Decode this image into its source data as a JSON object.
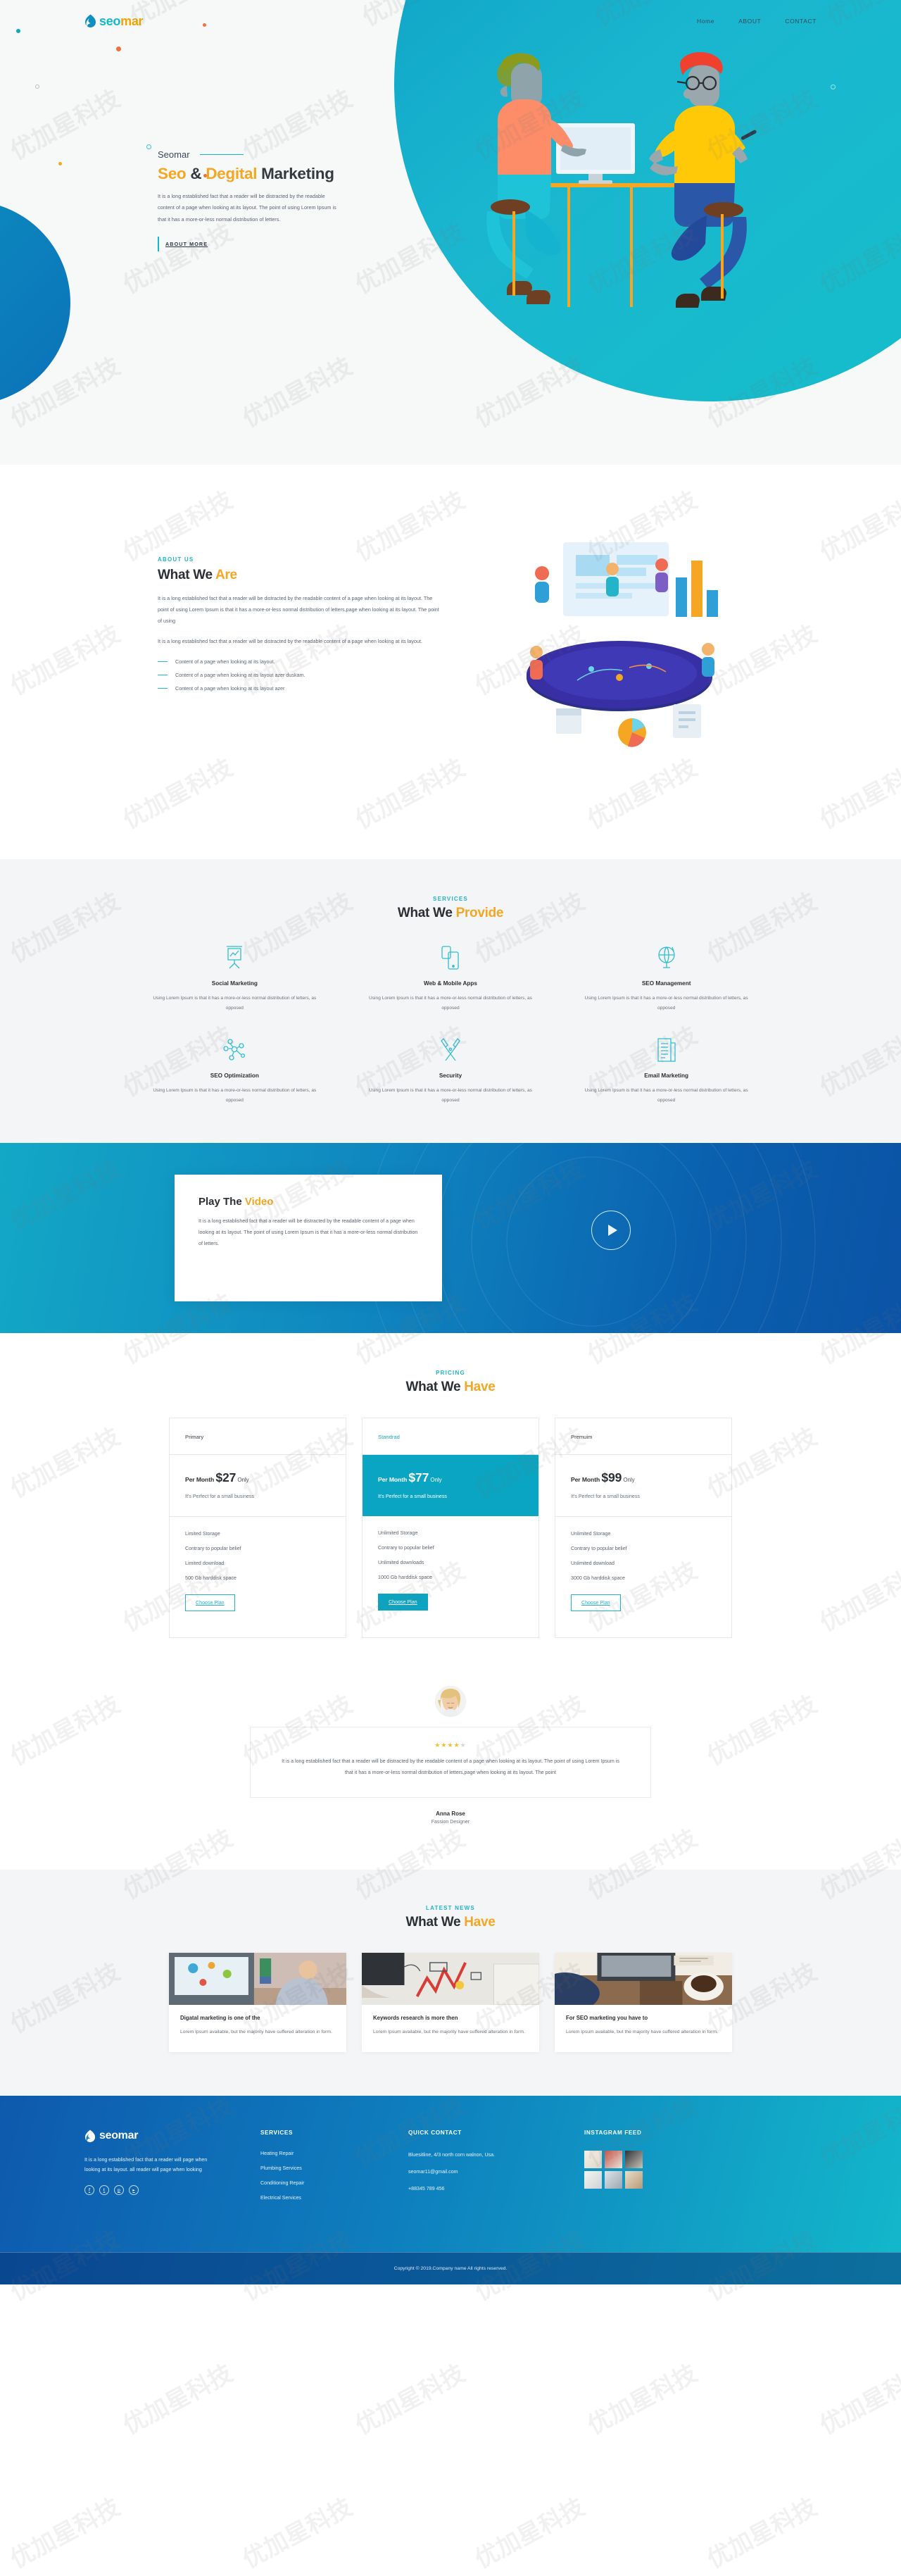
{
  "brand": {
    "name_part1": "seo",
    "name_part2": "mar",
    "full": "seomar",
    "accent_teal": "#16b8c8",
    "accent_orange": "#f0a500"
  },
  "nav": {
    "items": [
      {
        "label": "Home",
        "name": "nav-home"
      },
      {
        "label": "ABOUT",
        "name": "nav-about"
      },
      {
        "label": "CONTACT",
        "name": "nav-contact"
      }
    ]
  },
  "hero": {
    "eyebrow": "Seomar",
    "title_1": "Seo ",
    "title_amp": "& ",
    "title_2": "Degital ",
    "title_3": "Marketing",
    "paragraph": "It is a long established fact that a reader will be distracted by the readable content of a page when looking at its layout. The point of using Lorem Ipsum is that it has a more-or-less normal distribution of letters.",
    "button": "ABOUT MORE"
  },
  "about": {
    "kicker": "ABOUT US",
    "title_dark": "What We ",
    "title_accent": "Are",
    "paragraph_1": "It is a long established fact that a reader will be distracted by the readable content of a page when looking at its layout. The point of using Lorem Ipsum is that it has a more-or-less normal distribution of letters,page when looking at its layout. The point of using",
    "paragraph_2": "It is a long established fact that a reader will be distracted by the readable content of a page when looking at its layout.",
    "bullets": [
      "Content of a page when looking at its layout.",
      "Content of a page when looking at its layout azer duskam.",
      "Content of a page when looking at its layout azer"
    ]
  },
  "services": {
    "kicker": "SERVICES",
    "title_dark": "What We ",
    "title_accent": "Provide",
    "items": [
      {
        "icon": "presentation-chart-icon",
        "title": "Social Marketing",
        "desc": "Using Lorem Ipsum is that it has a more-or-less normal distribution of letters, as opposed"
      },
      {
        "icon": "mobile-devices-icon",
        "title": "Web & Mobile Apps",
        "desc": "Using Lorem Ipsum is that it has a more-or-less normal distribution of letters, as opposed"
      },
      {
        "icon": "globe-icon",
        "title": "SEO Management",
        "desc": "Using Lorem Ipsum is that it has a more-or-less normal distribution of letters, as opposed"
      },
      {
        "icon": "network-nodes-icon",
        "title": "SEO Optimization",
        "desc": "Using Lorem Ipsum is that it has a more-or-less normal distribution of letters, as opposed"
      },
      {
        "icon": "tools-wrench-icon",
        "title": "Security",
        "desc": "Using Lorem Ipsum is that it has a more-or-less normal distribution of letters, as opposed"
      },
      {
        "icon": "document-lines-icon",
        "title": "Email Marketing",
        "desc": "Using Lorem Ipsum is that it has a more-or-less normal distribution of letters, as opposed"
      }
    ]
  },
  "video": {
    "title_dark": "Play The ",
    "title_accent": "Video",
    "paragraph": "It is a long established fact that a reader will be distracted by the readable content of a page when looking at its layout. The point of using Lorem Ipsum is that it has a more-or-less normal distribution of letters.",
    "play_icon": "play-circle-icon"
  },
  "pricing": {
    "kicker": "PRICING",
    "title_dark": "What We ",
    "title_accent": "Have",
    "plans": [
      {
        "name": "Primary",
        "highlighted": false,
        "price_prefix": "Per Month ",
        "price": "$27",
        "price_suffix": " Only",
        "tagline": "It's Perfect for a small business",
        "features": [
          "Limited Storage",
          "Contrary to popular belief",
          "Limited download",
          "500 Gb harddisk space"
        ],
        "button": "Choose Plan"
      },
      {
        "name": "Standrad",
        "highlighted": true,
        "price_prefix": "Per Month ",
        "price": "$77",
        "price_suffix": " Only",
        "tagline": "It's Perfect for a small business",
        "features": [
          "Unlimited Storage",
          "Contrary to popular belief",
          "Unlimited downloads",
          "1000 Gb harddisk space"
        ],
        "button": "Choose Plan"
      },
      {
        "name": "Premuim",
        "highlighted": false,
        "price_prefix": "Per Month ",
        "price": "$99",
        "price_suffix": " Only",
        "tagline": "It's Perfect for a small business",
        "features": [
          "Unlimited Storage",
          "Contrary to popular belief",
          "Unlimited download",
          "3000 Gb harddisk space"
        ],
        "button": "Choose Plan"
      }
    ]
  },
  "testimonial": {
    "avatar": "user-avatar",
    "rating_filled": 4,
    "rating_total": 5,
    "quote": "It is a long established fact that a reader will be distracted by the readable content of a page when looking at its layout. The point of using Lorem Ipsum is that it has a more-or-less normal distribution of letters,page when looking at its layout. The point",
    "name": "Anna Rose",
    "role": "Fassion Designer"
  },
  "news": {
    "kicker": "LATEST NEWS",
    "title_dark": "What We ",
    "title_accent": "Have",
    "posts": [
      {
        "thumb": "desk-analytics-photo",
        "title": "Digatal marketing is one of the",
        "desc": "Lorem Ipsum available, but the majority have suffered alteration in form."
      },
      {
        "thumb": "keywords-research-photo",
        "title": "Keywords research is more then",
        "desc": "Lorem Ipsum available, but the majority have suffered alteration in form."
      },
      {
        "thumb": "laptop-coffee-photo",
        "title": "For SEO marketing you have to",
        "desc": "Lorem Ipsum available, but the majority have suffered alteration in form."
      }
    ]
  },
  "footer": {
    "description": "It is a long established fact that a reader will page when looking at its layout. all reader will page when looking",
    "socials": [
      {
        "icon": "facebook-icon",
        "glyph": "f"
      },
      {
        "icon": "twitter-icon",
        "glyph": "t"
      },
      {
        "icon": "pinterest-icon",
        "glyph": "p"
      },
      {
        "icon": "youtube-icon",
        "glyph": "▸"
      }
    ],
    "services": {
      "heading": "SERVICES",
      "items": [
        "Heating Repair",
        "Plumbing Services",
        "Conditioning Repair",
        "Electrical Services"
      ]
    },
    "contact": {
      "heading": "QUICK CONTACT",
      "address": "Bluesitline, 4/3 north corn walnon, Usa.",
      "email": "seomar11@gmail.com",
      "phone": "+88345 789 456"
    },
    "instagram": {
      "heading": "INSTAGRAM FEED",
      "tiles": [
        "ig-1",
        "ig-2",
        "ig-3",
        "ig-4",
        "ig-5",
        "ig-6"
      ]
    },
    "copyright": "Copyright © 2019.Company name All rights reserved."
  },
  "watermark": {
    "text": "优加星科技"
  }
}
